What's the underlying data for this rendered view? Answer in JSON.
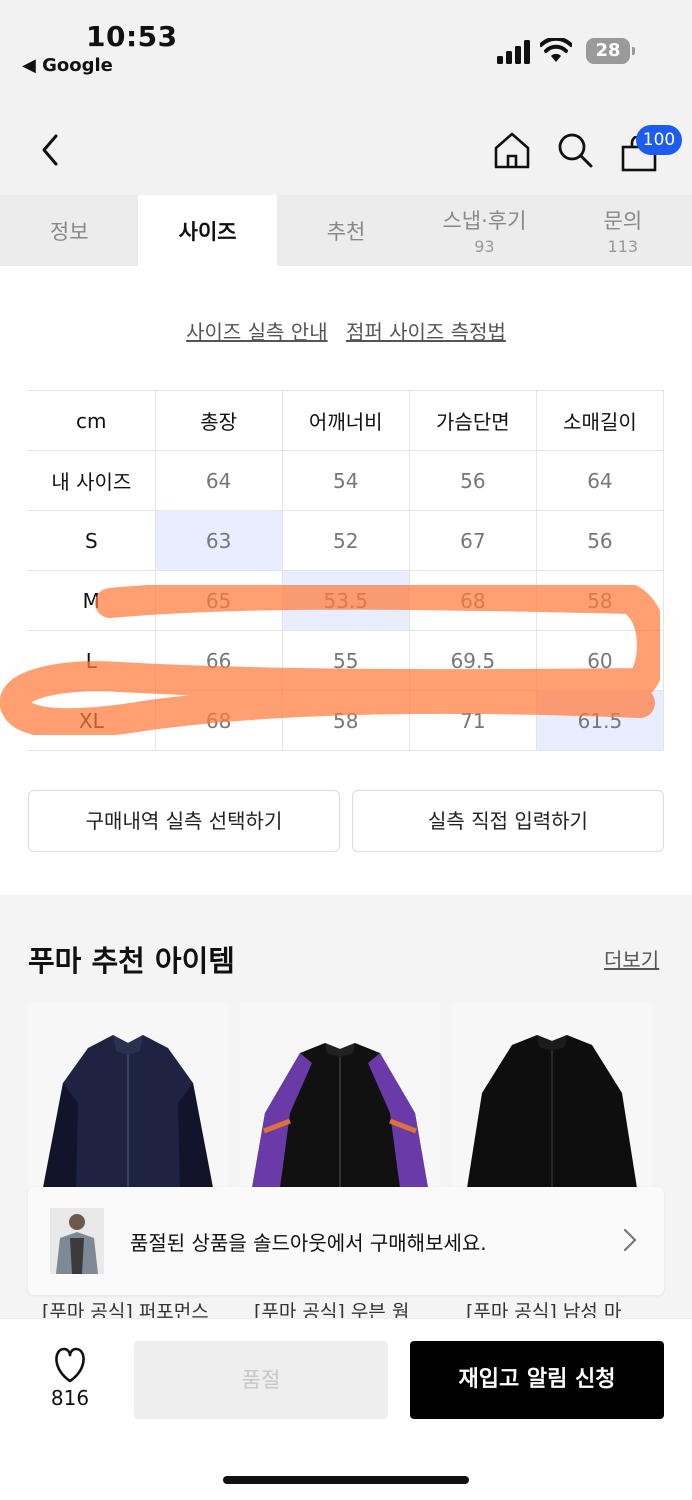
{
  "status_bar": {
    "time": "10:53",
    "back_app": "◀ Google",
    "battery": "28"
  },
  "nav": {
    "cart_count": "100"
  },
  "tabs": [
    {
      "label": "정보",
      "count": ""
    },
    {
      "label": "사이즈",
      "count": ""
    },
    {
      "label": "추천",
      "count": ""
    },
    {
      "label": "스냅·후기",
      "count": "93"
    },
    {
      "label": "문의",
      "count": "113"
    }
  ],
  "guides": {
    "measure_guide": "사이즈 실측 안내",
    "jumper_method": "점퍼 사이즈 측정법"
  },
  "size_table": {
    "headers": [
      "cm",
      "총장",
      "어깨너비",
      "가슴단면",
      "소매길이"
    ],
    "rows": [
      [
        "내 사이즈",
        "64",
        "54",
        "56",
        "64"
      ],
      [
        "S",
        "63",
        "52",
        "67",
        "56"
      ],
      [
        "M",
        "65",
        "53.5",
        "68",
        "58"
      ],
      [
        "L",
        "66",
        "55",
        "69.5",
        "60"
      ],
      [
        "XL",
        "68",
        "58",
        "71",
        "61.5"
      ]
    ]
  },
  "buttons": {
    "purchase_history": "구매내역 실측 선택하기",
    "direct_input": "실측 직접 입력하기"
  },
  "recommend": {
    "title": "푸마 추천 아이템",
    "more": "더보기",
    "products": [
      "[푸마 공식] 퍼포먼스",
      "[푸마 공식] 우븐 웜",
      "[푸마 공식] 남성 마"
    ],
    "sold_banner": "품절된 상품을 솔드아웃에서 구매해보세요."
  },
  "bottom": {
    "likes": "816",
    "soldout": "품절",
    "notify": "재입고 알림 신청"
  },
  "colors": {
    "accent": "#1d5cf0",
    "highlight_cell": "#e8eeff",
    "annotation": "#ff7a3c"
  }
}
